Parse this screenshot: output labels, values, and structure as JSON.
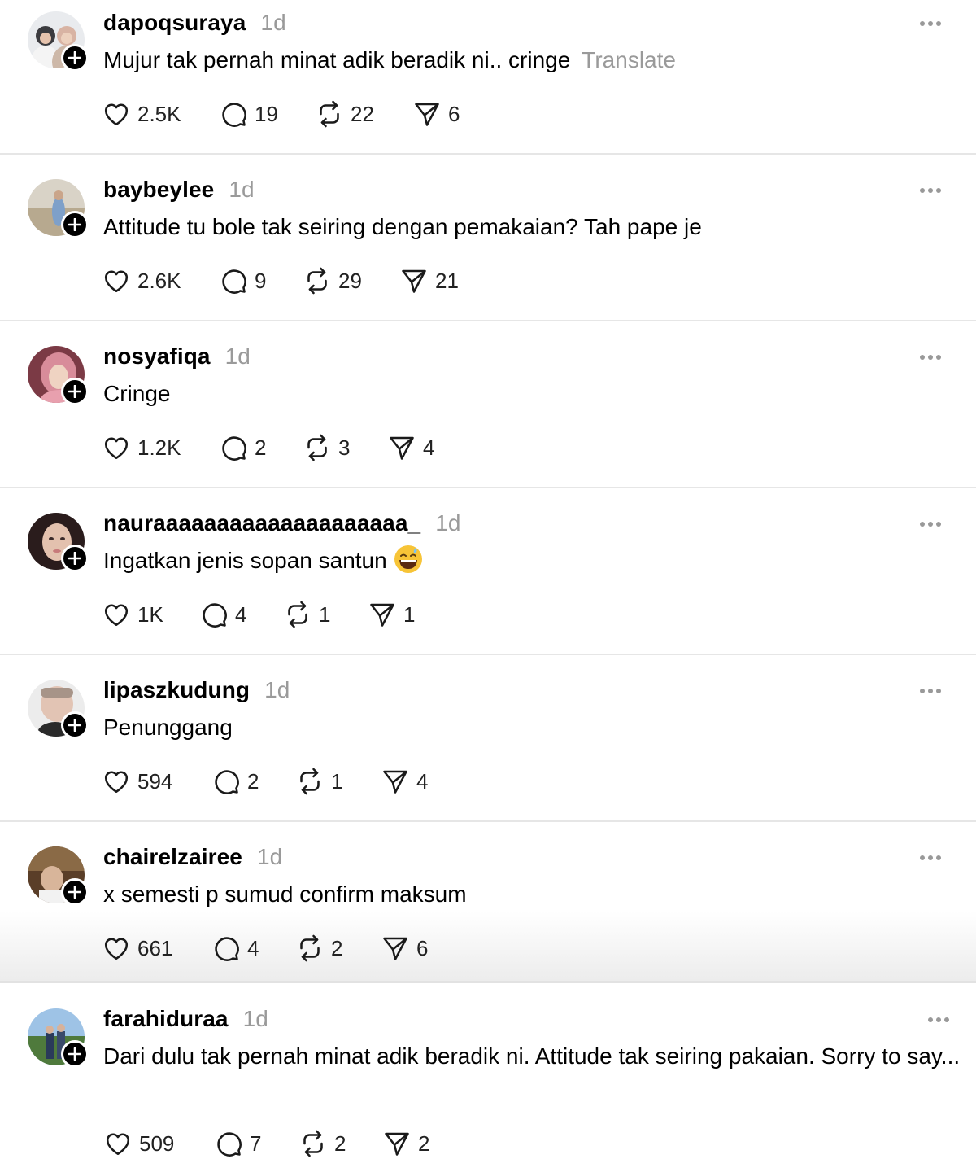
{
  "posts": [
    {
      "username": "dapoqsuraya",
      "time": "1d",
      "text": "Mujur tak pernah minat adik beradik ni.. cringe",
      "translate": "Translate",
      "likes": "2.5K",
      "replies": "19",
      "reposts": "22",
      "shares": "6"
    },
    {
      "username": "baybeylee",
      "time": "1d",
      "text": "Attitude tu bole tak seiring dengan pemakaian? Tah pape je",
      "likes": "2.6K",
      "replies": "9",
      "reposts": "29",
      "shares": "21"
    },
    {
      "username": "nosyafiqa",
      "time": "1d",
      "text": "Cringe",
      "likes": "1.2K",
      "replies": "2",
      "reposts": "3",
      "shares": "4"
    },
    {
      "username": "nauraaaaaaaaaaaaaaaaaaaa_",
      "time": "1d",
      "text": "Ingatkan jenis sopan santun",
      "emoji": "grinning-face-with-sweat",
      "likes": "1K",
      "replies": "4",
      "reposts": "1",
      "shares": "1"
    },
    {
      "username": "lipaszkudung",
      "time": "1d",
      "text": "Penunggang",
      "likes": "594",
      "replies": "2",
      "reposts": "1",
      "shares": "4"
    },
    {
      "username": "chairelzairee",
      "time": "1d",
      "text": "x semesti p sumud confirm maksum",
      "likes": "661",
      "replies": "4",
      "reposts": "2",
      "shares": "6"
    },
    {
      "username": "farahiduraa",
      "time": "1d",
      "text": "Dari dulu tak pernah minat adik beradik ni. Attitude tak seiring pakaian. Sorry to say...",
      "likes": "509",
      "replies": "7",
      "reposts": "2",
      "shares": "2"
    }
  ],
  "icons": {
    "like": "heart-icon",
    "reply": "comment-bubble-icon",
    "repost": "repost-icon",
    "share": "send-paper-plane-icon",
    "more": "more-options-icon",
    "follow": "follow-plus-icon"
  },
  "colors": {
    "muted": "#9a9a9a",
    "text": "#000000",
    "divider": "#e6e6e6"
  }
}
